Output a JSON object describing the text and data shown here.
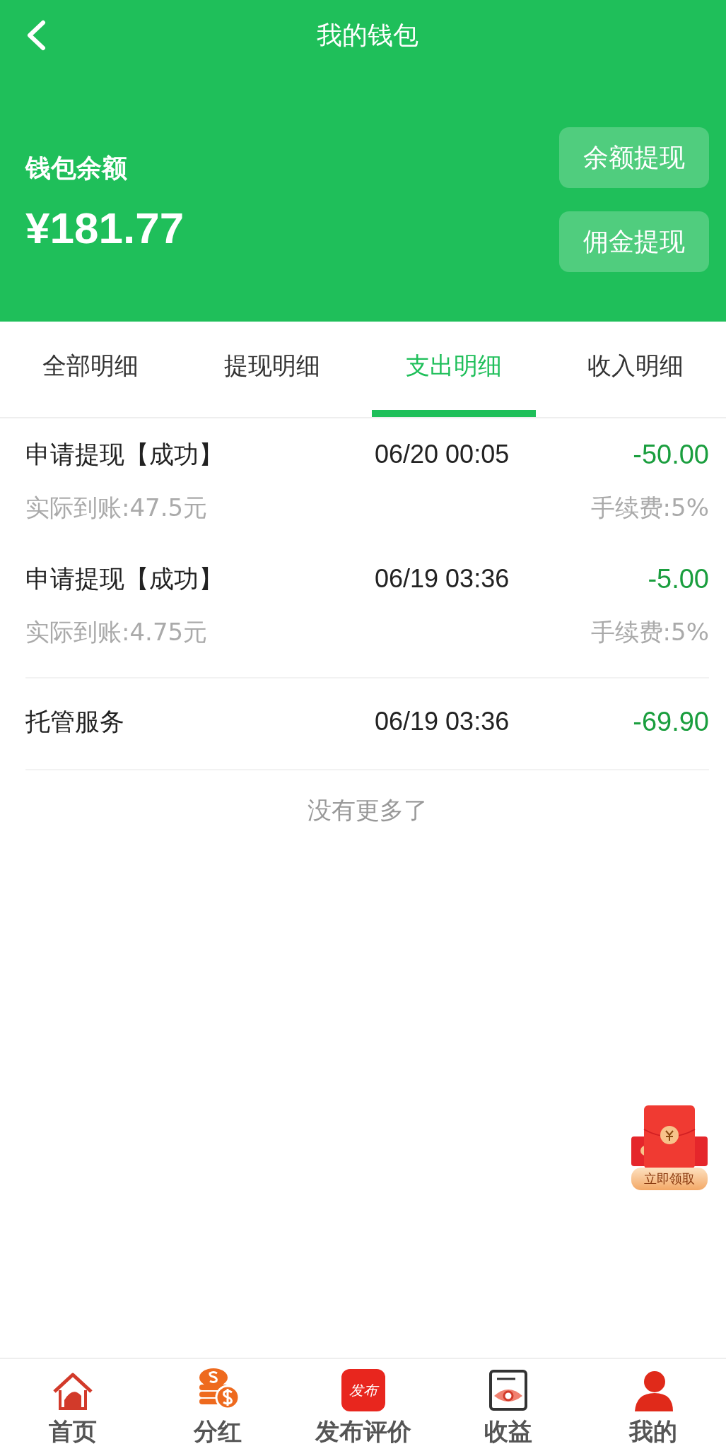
{
  "header": {
    "title": "我的钱包"
  },
  "wallet": {
    "label": "钱包余额",
    "amount": "¥181.77",
    "buttons": [
      "余额提现",
      "佣金提现"
    ]
  },
  "tabs": [
    {
      "label": "全部明细",
      "selected": false
    },
    {
      "label": "提现明细",
      "selected": false
    },
    {
      "label": "支出明细",
      "selected": true
    },
    {
      "label": "收入明细",
      "selected": false
    }
  ],
  "records": [
    {
      "title": "申请提现【成功】",
      "time": "06/20 00:05",
      "amount": "-50.00",
      "actual": "实际到账:47.5元",
      "fee": "手续费:5%"
    },
    {
      "title": "申请提现【成功】",
      "time": "06/19 03:36",
      "amount": "-5.00",
      "actual": "实际到账:4.75元",
      "fee": "手续费:5%"
    },
    {
      "title": "托管服务",
      "time": "06/19 03:36",
      "amount": "-69.90"
    }
  ],
  "end_note": "没有更多了",
  "promo": {
    "label": "立即领取"
  },
  "nav": [
    {
      "label": "首页",
      "kind": "home"
    },
    {
      "label": "分红",
      "kind": "coins"
    },
    {
      "label": "发布评价",
      "kind": "publish",
      "badge": "发布"
    },
    {
      "label": "收益",
      "kind": "eye"
    },
    {
      "label": "我的",
      "kind": "user"
    }
  ]
}
